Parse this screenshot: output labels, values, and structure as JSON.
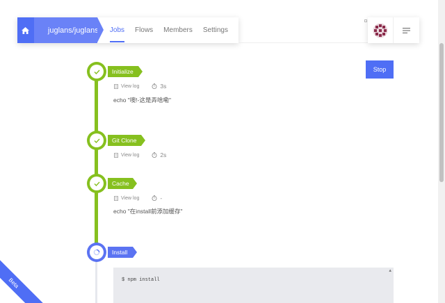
{
  "header": {
    "repo": "juglans/juglans",
    "tabs": [
      {
        "label": "Jobs",
        "active": true
      },
      {
        "label": "Flows",
        "active": false
      },
      {
        "label": "Members",
        "active": false
      },
      {
        "label": "Settings",
        "active": false
      }
    ],
    "home_icon": "home-icon",
    "menu_icon": "hamburger-icon"
  },
  "actions": {
    "stop_label": "Stop"
  },
  "steps": [
    {
      "name": "Initialize",
      "status": "success",
      "view_log": "View log",
      "duration": "3s",
      "command": "echo \"噢!-这是弄啥嘞\""
    },
    {
      "name": "Git Clone",
      "status": "success",
      "view_log": "View log",
      "duration": "2s",
      "command": ""
    },
    {
      "name": "Cache",
      "status": "success",
      "view_log": "View log",
      "duration": "-",
      "command": "echo \"在install前添加缓存\""
    },
    {
      "name": "Install",
      "status": "running"
    }
  ],
  "terminal": {
    "line": "$ npm install"
  },
  "ribbon": "Beta",
  "colors": {
    "primary": "#4f6ef5",
    "success": "#86c01f"
  }
}
